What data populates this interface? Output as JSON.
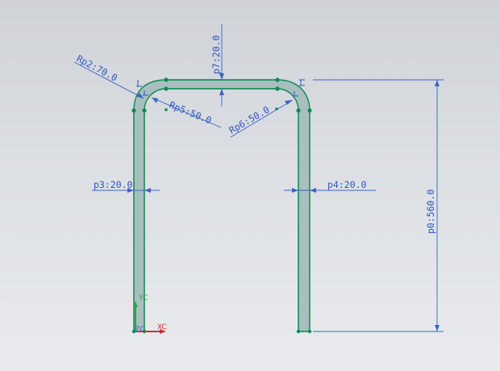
{
  "dimensions": {
    "p0": "p0:560.0",
    "p3": "p3:20.0",
    "p4": "p4:20.0",
    "p7": "p7:20.0",
    "rp2": "Rp2:70.0",
    "rp5": "Rp5:50.0",
    "rp6": "Rp6:50.0"
  },
  "csys": {
    "yc": "YC",
    "xc": "XC",
    "zc": "ZC"
  },
  "colors": {
    "dimension": "#3c63c6",
    "sketch_edge": "#0f8a52",
    "profile_fill": "#a9bfbf",
    "axis_x": "#c83232",
    "axis_y": "#2fa84a"
  }
}
